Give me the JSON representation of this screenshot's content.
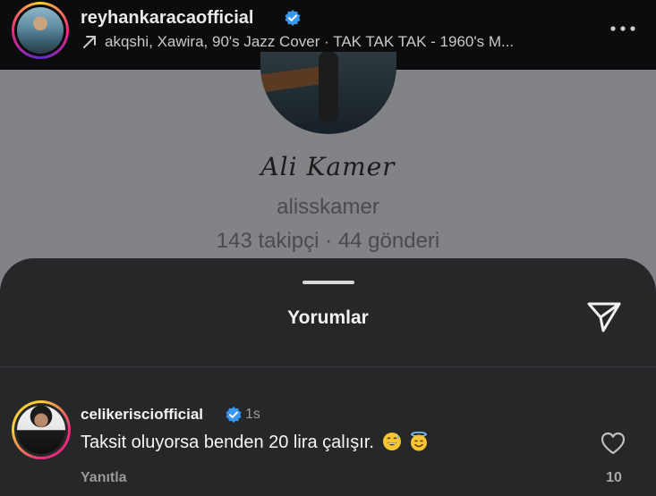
{
  "header": {
    "username": "reyhankaracaofficial",
    "music": "akqshi, Xawira, 90's Jazz Cover · TAK TAK TAK - 1960's M..."
  },
  "profile": {
    "display_name": "Ali Kamer",
    "handle": "alisskamer",
    "stats": "143 takipçi · 44 gönderi"
  },
  "comments_sheet": {
    "title": "Yorumlar",
    "comments": [
      {
        "username": "celikerisciofficial",
        "time": "1s",
        "text": "Taksit oluyorsa benden 20 lira çalışır.",
        "reply_label": "Yanıtla",
        "likes": "10"
      }
    ]
  },
  "colors": {
    "verified": "#3897f0",
    "sheet_bg": "#262729",
    "topbar_bg": "#0b0c0d"
  },
  "icons": [
    "verified-icon",
    "arrow-up-right-icon",
    "more-icon",
    "send-icon",
    "heart-icon",
    "grinning-sweat-emoji",
    "smiling-halo-emoji"
  ]
}
